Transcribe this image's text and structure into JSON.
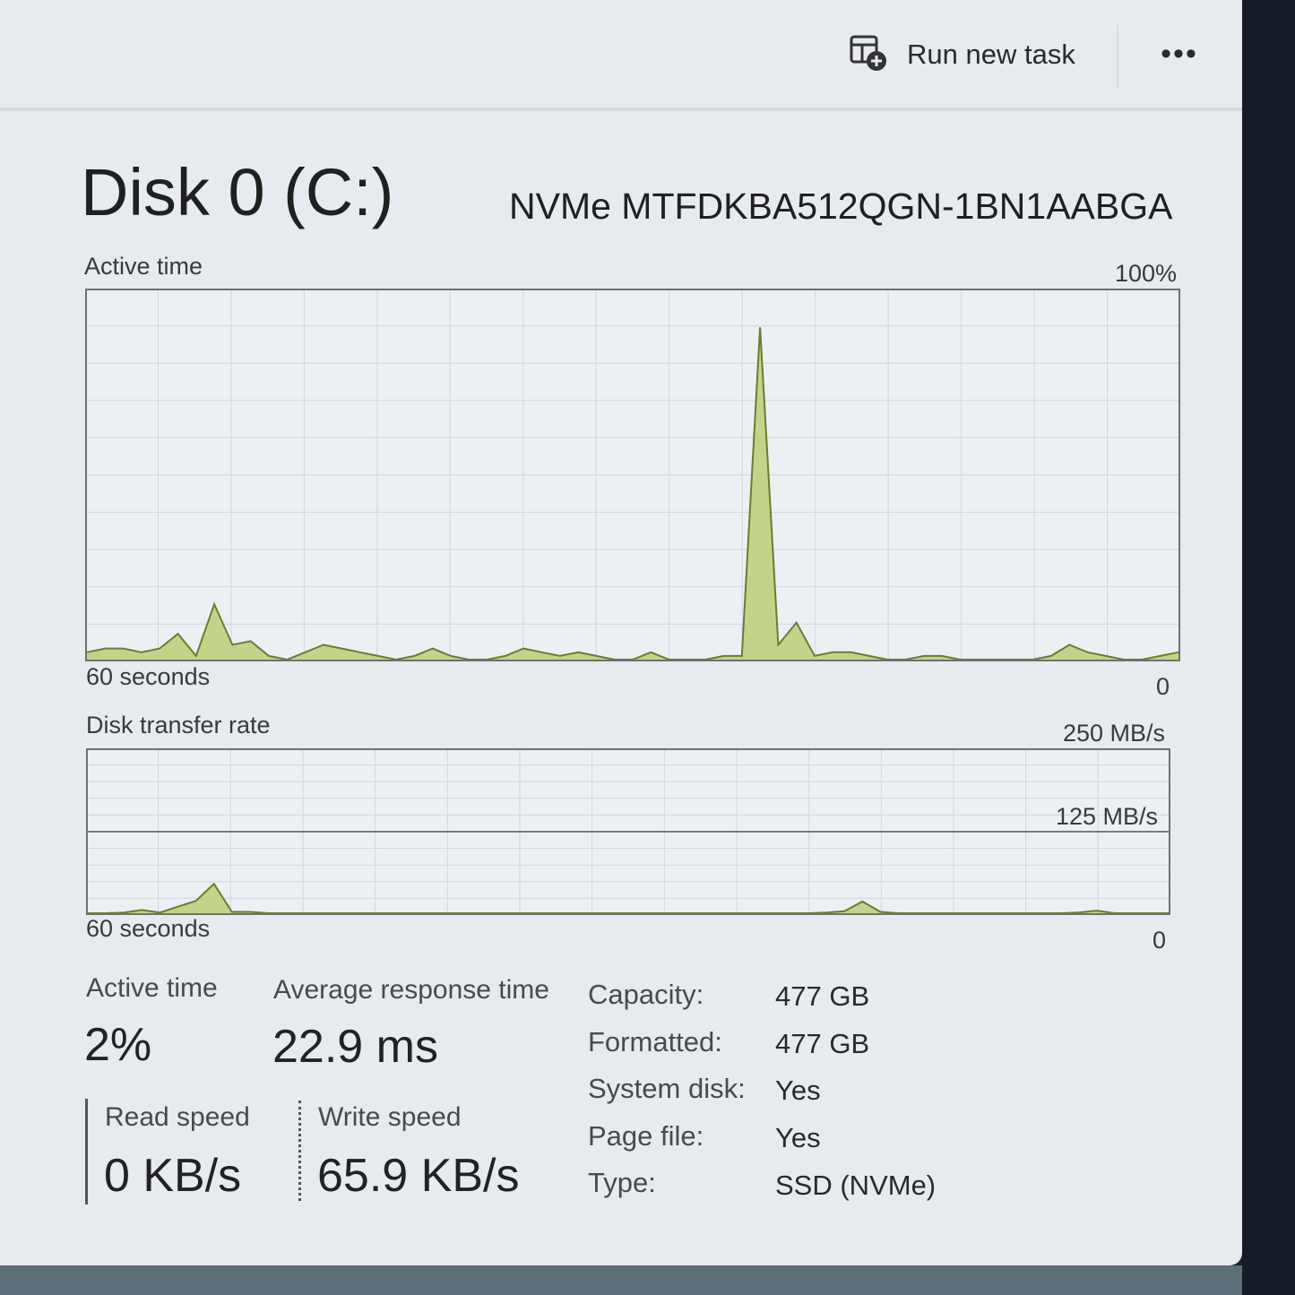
{
  "toolbar": {
    "run_new_task": "Run new task",
    "more_label": "•••"
  },
  "header": {
    "title": "Disk 0 (C:)",
    "model": "NVMe MTFDKBA512QGN-1BN1AABGA"
  },
  "active_time_graph": {
    "label": "Active time",
    "max_label": "100%",
    "time_label": "60 seconds",
    "min_label": "0"
  },
  "transfer_graph": {
    "label": "Disk transfer rate",
    "max_label": "250 MB/s",
    "mid_label": "125 MB/s",
    "time_label": "60 seconds",
    "min_label": "0"
  },
  "stats": {
    "active_time_label": "Active time",
    "active_time_value": "2%",
    "avg_response_label": "Average response time",
    "avg_response_value": "22.9 ms",
    "read_speed_label": "Read speed",
    "read_speed_value": "0 KB/s",
    "write_speed_label": "Write speed",
    "write_speed_value": "65.9 KB/s"
  },
  "properties": [
    {
      "label": "Capacity:",
      "value": "477 GB"
    },
    {
      "label": "Formatted:",
      "value": "477 GB"
    },
    {
      "label": "System disk:",
      "value": "Yes"
    },
    {
      "label": "Page file:",
      "value": "Yes"
    },
    {
      "label": "Type:",
      "value": "SSD (NVMe)"
    }
  ],
  "colors": {
    "fill": "#c3d48a",
    "line": "#6a7d30",
    "grid": "#cfd5dc",
    "border": "#707070"
  },
  "chart_data": [
    {
      "type": "area",
      "title": "Active time",
      "xlabel": "60 seconds",
      "ylim": [
        0,
        100
      ],
      "x": [
        60,
        59,
        58,
        57,
        56,
        55,
        54,
        53,
        52,
        51,
        50,
        49,
        48,
        47,
        46,
        45,
        44,
        43,
        42,
        41,
        40,
        39,
        38,
        37,
        36,
        35,
        34,
        33,
        32,
        31,
        30,
        29,
        28,
        27,
        26,
        25,
        24,
        23,
        22,
        21,
        20,
        19,
        18,
        17,
        16,
        15,
        14,
        13,
        12,
        11,
        10,
        9,
        8,
        7,
        6,
        5,
        4,
        3,
        2,
        1,
        0
      ],
      "series": [
        {
          "values": [
            2,
            3,
            3,
            2,
            3,
            7,
            1,
            15,
            4,
            5,
            1,
            0,
            2,
            4,
            3,
            2,
            1,
            0,
            1,
            3,
            1,
            0,
            0,
            1,
            3,
            2,
            1,
            2,
            1,
            0,
            0,
            2,
            0,
            0,
            0,
            1,
            1,
            90,
            4,
            10,
            1,
            2,
            2,
            1,
            0,
            0,
            1,
            1,
            0,
            0,
            0,
            0,
            0,
            1,
            4,
            2,
            1,
            0,
            0,
            1,
            2
          ]
        }
      ]
    },
    {
      "type": "area",
      "title": "Disk transfer rate",
      "xlabel": "60 seconds",
      "ylim": [
        0,
        250
      ],
      "series": [
        {
          "values": [
            0,
            0,
            1,
            5,
            1,
            10,
            19,
            45,
            2,
            2,
            0,
            0,
            0,
            0,
            0,
            0,
            0,
            0,
            0,
            0,
            0,
            0,
            0,
            0,
            0,
            0,
            0,
            0,
            0,
            0,
            0,
            0,
            0,
            0,
            0,
            0,
            0,
            0,
            0,
            0,
            0,
            1,
            3,
            18,
            2,
            0,
            0,
            0,
            0,
            0,
            0,
            0,
            0,
            0,
            0,
            1,
            4,
            0,
            0,
            0,
            0
          ]
        }
      ]
    }
  ]
}
